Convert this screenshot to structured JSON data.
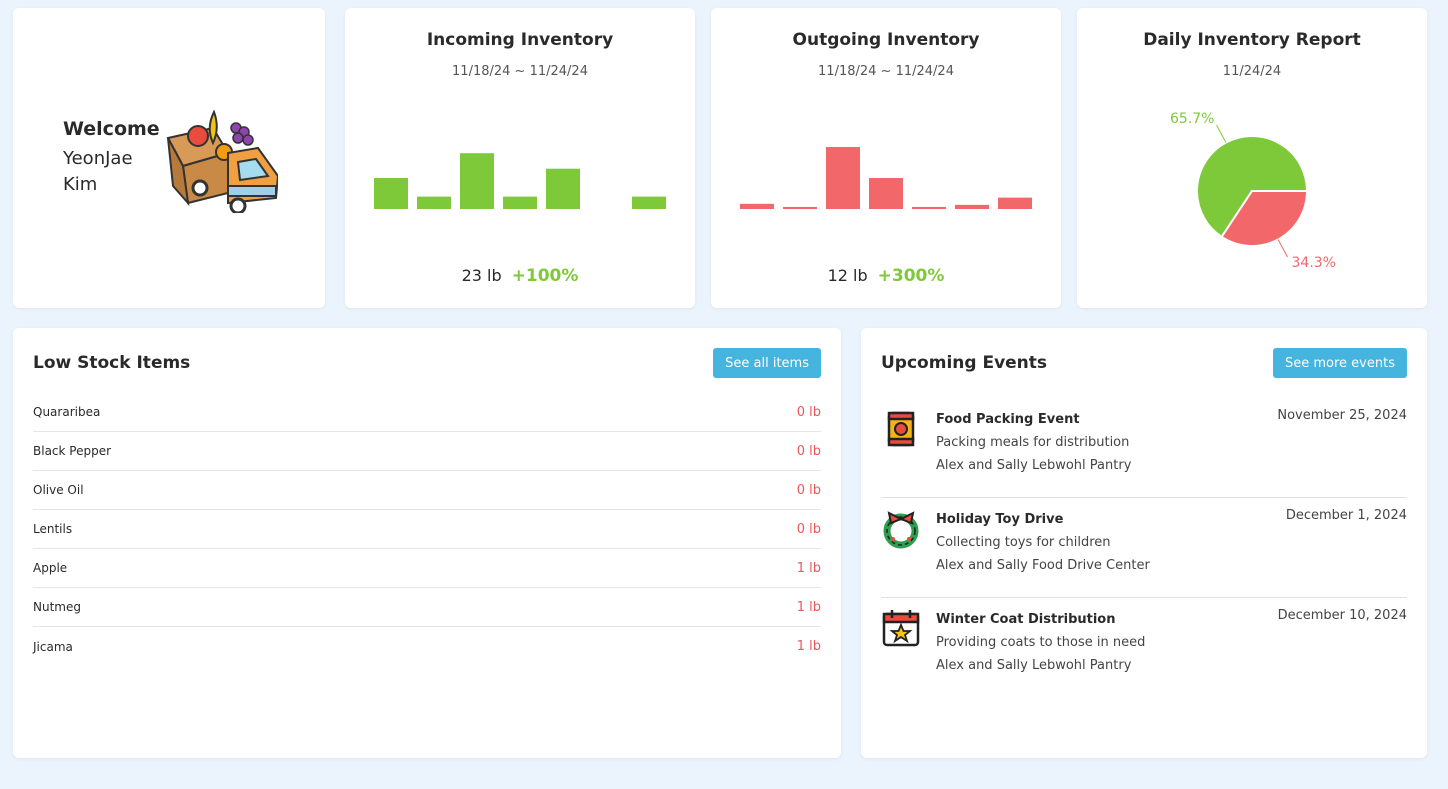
{
  "welcome": {
    "title": "Welcome",
    "name": "YeonJae Kim"
  },
  "incoming": {
    "title": "Incoming Inventory",
    "date_range": "11/18/24 ~ 11/24/24",
    "total": "23 lb",
    "change": "+100%",
    "color": "#7ec93a",
    "chart_data": {
      "type": "bar",
      "values": [
        5,
        2,
        9,
        2,
        6.5,
        0,
        2
      ],
      "ylim": [
        0,
        10
      ]
    }
  },
  "outgoing": {
    "title": "Outgoing Inventory",
    "date_range": "11/18/24 ~ 11/24/24",
    "total": "12 lb",
    "change": "+300%",
    "color": "#f2676a",
    "chart_data": {
      "type": "bar",
      "values": [
        0.5,
        0.2,
        6,
        3,
        0.2,
        0.4,
        1.1
      ],
      "ylim": [
        0,
        6
      ]
    }
  },
  "report": {
    "title": "Daily Inventory Report",
    "date": "11/24/24",
    "chart_data": {
      "type": "pie",
      "slices": [
        {
          "value": 65.7,
          "label": "65.7%",
          "color": "#7ec93a"
        },
        {
          "value": 34.3,
          "label": "34.3%",
          "color": "#f2676a"
        }
      ]
    }
  },
  "low_stock": {
    "title": "Low Stock Items",
    "button": "See all items",
    "items": [
      {
        "name": "Quararibea",
        "qty": "0 lb"
      },
      {
        "name": "Black Pepper",
        "qty": "0 lb"
      },
      {
        "name": "Olive Oil",
        "qty": "0 lb"
      },
      {
        "name": "Lentils",
        "qty": "0 lb"
      },
      {
        "name": "Apple",
        "qty": "1 lb"
      },
      {
        "name": "Nutmeg",
        "qty": "1 lb"
      },
      {
        "name": "Jicama",
        "qty": "1 lb"
      }
    ]
  },
  "events": {
    "title": "Upcoming Events",
    "button": "See more events",
    "items": [
      {
        "name": "Food Packing Event",
        "desc": "Packing meals for distribution",
        "location": "Alex and Sally Lebwohl Pantry",
        "date": "November 25, 2024",
        "icon": "can-icon"
      },
      {
        "name": "Holiday Toy Drive",
        "desc": "Collecting toys for children",
        "location": "Alex and Sally Food Drive Center",
        "date": "December 1, 2024",
        "icon": "wreath-icon"
      },
      {
        "name": "Winter Coat Distribution",
        "desc": "Providing coats to those in need",
        "location": "Alex and Sally Lebwohl Pantry",
        "date": "December 10, 2024",
        "icon": "calendar-star-icon"
      }
    ]
  }
}
